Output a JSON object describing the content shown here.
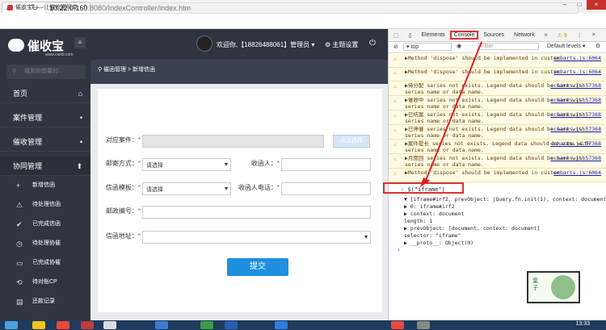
{
  "browser": {
    "tab_title": "催收宝——让催收更简单",
    "url_host": "10.22.0.160",
    "url_rest": ":8080/IndexController/index.htm",
    "back_icon": "back-arrow-icon",
    "forward_icon": "forward-arrow-icon",
    "reload_icon": "reload-icon"
  },
  "app": {
    "logo_text": "催收宝",
    "logo_sub": "www.cuisb.com",
    "search_placeholder": "我到你想要的...",
    "header": {
      "welcome": "欢迎你,【18826488061】管理员 ▾",
      "theme": "⚙ 主题设置",
      "power_icon": "power-icon"
    },
    "breadcrumb": "催函管理 > 新增信函",
    "nav": [
      {
        "label": "首页",
        "icon": "home-icon",
        "mark": "⌂"
      },
      {
        "label": "案件管理",
        "mark": "•"
      },
      {
        "label": "催收管理",
        "mark": "•"
      },
      {
        "label": "协同管理",
        "mark": "⬆"
      }
    ],
    "sub_nav": [
      {
        "label": "新增信函",
        "mark": "+"
      },
      {
        "label": "待处理信函",
        "mark": "⚠"
      },
      {
        "label": "已完成信函",
        "mark": "✔"
      },
      {
        "label": "待处理协催",
        "mark": "◷"
      },
      {
        "label": "已完成协催",
        "mark": "▭"
      },
      {
        "label": "待对账CP",
        "mark": "⟲"
      },
      {
        "label": "还款记录",
        "mark": "▤"
      }
    ],
    "form": {
      "case_label": "对应案件：",
      "pick_button": "点击选择",
      "mail_method_label": "邮寄方式：",
      "mail_method_value": "请选择",
      "recipient_label": "收函人：",
      "template_label": "信函模板：",
      "template_value": "请选择",
      "recipient_phone_label": "收函人电话：",
      "postcode_label": "邮政编号：",
      "address_label": "信函地址：",
      "required_mark": "*",
      "submit": "提交"
    }
  },
  "devtools": {
    "tabs": [
      "Elements",
      "Console",
      "Sources",
      "Network",
      "»"
    ],
    "active_tab": "Console",
    "warn_count": "⚠ 9",
    "context": "top",
    "filter_placeholder": "Filter",
    "levels": "Default levels ▾",
    "messages": [
      {
        "text": "▶Method 'dispose' should be implemented in custom.",
        "src": "echarts.js:6064"
      },
      {
        "text": "▶Method 'dispose' should be implemented in custom.",
        "src": "echarts.js:6064"
      },
      {
        "text": "▶待分配 series not exists. Legend data should be same with series name or data name.",
        "src": "echarts.js:57368"
      },
      {
        "text": "▶催收中 series not exists. Legend data should be same with series name or data name.",
        "src": "echarts.js:57368"
      },
      {
        "text": "▶已结案 series not exists. Legend data should be same with series name or data name.",
        "src": "echarts.js:57368"
      },
      {
        "text": "▶已停催 series not exists. Legend data should be same with series name or data name.",
        "src": "echarts.js:57368"
      },
      {
        "text": "▶案件提长 series not exists. Legend data should be same with series name or data name.",
        "src": "echarts.js:57368"
      },
      {
        "text": "▶月度回 series not exists. Legend data should be same with series name or data name.",
        "src": "echarts.js:57368"
      },
      {
        "text": "▶Method 'dispose' should be implemented in custom.",
        "src": "echarts.js:6064"
      }
    ],
    "command": "$(\"iframe\")",
    "result_lines": [
      "▼ [iframe#irf2, prevObject: jQuery.fn.init(1), context: document, sel",
      "  ▶ 0: iframe#irf2",
      "  ▶ context: document",
      "    length: 1",
      "  ▶ prevObject: [document, context: document]",
      "    selector: \"iframe\"",
      "  ▶ __proto__: Object(0)"
    ],
    "prompt": "›"
  },
  "stamp": {
    "text": "葉子"
  },
  "taskbar": {
    "clock": "13:33"
  }
}
